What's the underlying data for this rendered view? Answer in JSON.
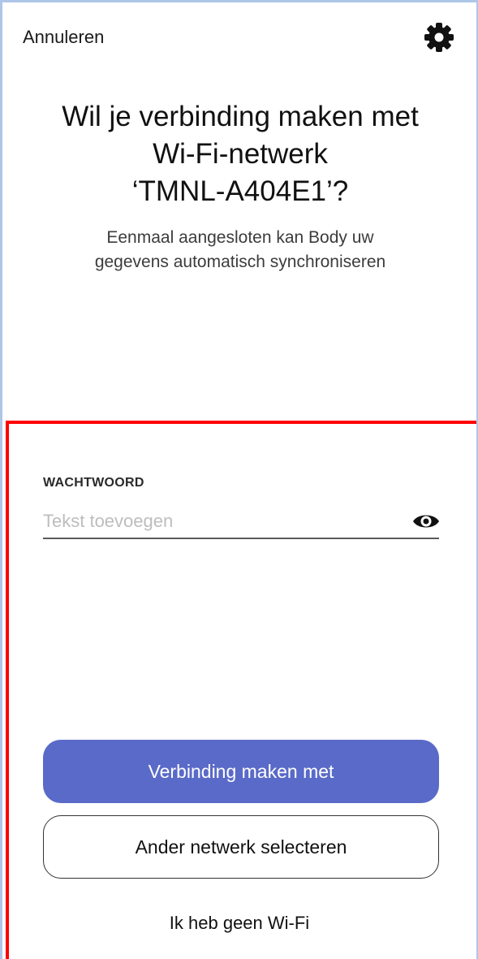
{
  "header": {
    "cancel_label": "Annuleren",
    "settings_icon": "gear-icon"
  },
  "main": {
    "title_line1": "Wil je verbinding maken met",
    "title_line2": "Wi-Fi-netwerk",
    "title_line3": "‘TMNL-A404E1’?",
    "subtitle_line1": "Eenmaal aangesloten kan Body uw",
    "subtitle_line2": "gegevens automatisch synchroniseren"
  },
  "password": {
    "label": "WACHTWOORD",
    "value": "",
    "placeholder": "Tekst toevoegen",
    "toggle_icon": "eye-icon"
  },
  "actions": {
    "connect_label": "Verbinding maken met",
    "other_network_label": "Ander netwerk selecteren",
    "no_wifi_label": "Ik heb geen Wi-Fi"
  },
  "colors": {
    "primary": "#5a6ac8",
    "highlight": "#ff0000",
    "background": "#ffffff"
  }
}
